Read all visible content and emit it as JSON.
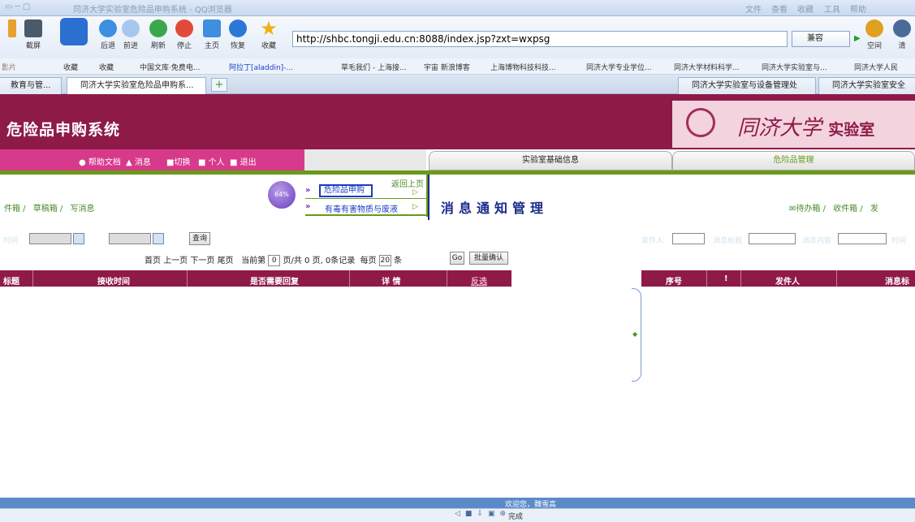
{
  "browser": {
    "window_title": "同济大学实验室危险品申购系统 - QQ浏览器",
    "title_menu": [
      "文件",
      "查看",
      "收藏",
      "工具",
      "帮助"
    ],
    "nav_buttons": {
      "screenshot": "截屏",
      "back": "后退",
      "forward": "前进",
      "refresh": "刷新",
      "stop": "停止",
      "home": "主页",
      "restore": "恢复",
      "favorites": "收藏"
    },
    "address": "http://shbc.tongji.edu.cn:8088/index.jsp?zxt=wxpsg",
    "compat_mode": "兼容",
    "right_buttons": {
      "space": "空间",
      "clear": "清"
    },
    "favorites_bar": [
      "收藏",
      "收藏",
      "中国文库·免费电...",
      "阿拉丁[aladdin]-...",
      "草毛我们 - 上海接...",
      "宇宙 新浪博客",
      "上海博物科技科技...",
      "同济大学专业学位...",
      "同济大学材料科学...",
      "同济大学实验室与...",
      "同济大学人民"
    ],
    "tabs": [
      "教育与管...",
      "同济大学实验室危险品申购系...",
      "同济大学实验室与设备管理处",
      "同济大学实验室安全"
    ]
  },
  "app": {
    "title": "危险品申购系统",
    "university": "同济大学",
    "university_suffix": "实验室",
    "top_menu": [
      "帮助文档",
      "消息",
      "切换",
      "个人",
      "退出"
    ],
    "section_tabs": [
      "实验室基础信息",
      "危险品管理"
    ],
    "left_breadcrumb": [
      "件箱",
      "草稿箱",
      "写消息"
    ],
    "progress": "64%",
    "popmenu": {
      "back": "返回上页",
      "item1": "危险品申购",
      "item2": "有毒有害物质与废液"
    },
    "page_heading": "消息通知管理",
    "right_breadcrumb": [
      "待办箱",
      "收件箱",
      "发"
    ],
    "left_filter": {
      "date_label": "时间",
      "query_button": "查询"
    },
    "pager": {
      "first": "首页",
      "prev": "上一页",
      "next": "下一页",
      "last": "尾页",
      "current_prefix": "当前第",
      "current": "0",
      "total_text": "页/共 0 页, 0条记录",
      "per_page_prefix": "每页",
      "per_page": "20",
      "per_page_suffix": "条",
      "go": "Go",
      "batch": "批量确认"
    },
    "left_columns": [
      "标题",
      "接收时间",
      "是否需要回复",
      "详 情",
      "反选"
    ],
    "right_filter": [
      "发件人",
      "消息标题",
      "消息内容",
      "时间"
    ],
    "right_columns": [
      "序号",
      "!",
      "发件人",
      "消息标"
    ],
    "welcome": "欢迎您，魏雪高",
    "status_done": "完成"
  },
  "colors": {
    "brand": "#8e1a48",
    "accent_pink": "#d73a8b",
    "green": "#6a9a1a",
    "navy": "#1a2a8a"
  }
}
